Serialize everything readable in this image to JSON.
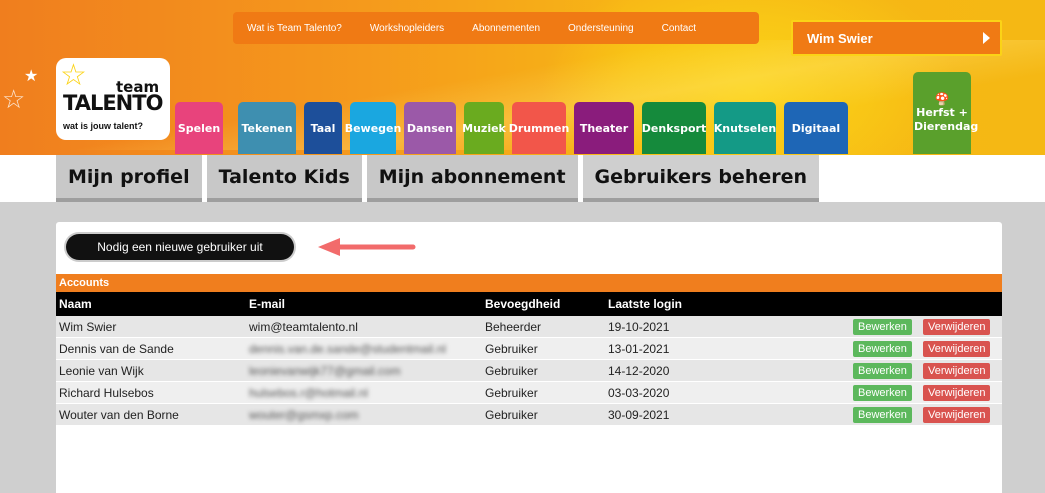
{
  "topnav": {
    "links": [
      "Wat is Team Talento?",
      "Workshopleiders",
      "Abonnementen",
      "Ondersteuning",
      "Contact"
    ]
  },
  "user": {
    "name": "Wim Swier"
  },
  "logo": {
    "line1": "team",
    "line2": "TALENTO",
    "tagline": "wat is jouw talent?"
  },
  "categories": [
    {
      "label": "Spelen",
      "color": "#e8437c"
    },
    {
      "label": "Tekenen",
      "color": "#3e8fb0"
    },
    {
      "label": "Taal",
      "color": "#1d4f9a"
    },
    {
      "label": "Bewegen",
      "color": "#1aa7e0"
    },
    {
      "label": "Dansen",
      "color": "#9b59a8"
    },
    {
      "label": "Muziek",
      "color": "#6aab1f"
    },
    {
      "label": "Drummen",
      "color": "#f2564a"
    },
    {
      "label": "Theater",
      "color": "#8a1c7c"
    },
    {
      "label": "Denksport",
      "color": "#158a3c"
    },
    {
      "label": "Knutselen",
      "color": "#149a86"
    },
    {
      "label": "Digitaal",
      "color": "#1e66b6"
    },
    {
      "label": "Herfst + Dierendag",
      "color": "#5aa02c"
    }
  ],
  "profile_tabs": [
    "Mijn profiel",
    "Talento Kids",
    "Mijn abonnement",
    "Gebruikers beheren"
  ],
  "invite_button": "Nodig een nieuwe gebruiker uit",
  "table": {
    "title": "Accounts",
    "headers": [
      "Naam",
      "E-mail",
      "Bevoegdheid",
      "Laatste login"
    ],
    "edit_label": "Bewerken",
    "delete_label": "Verwijderen",
    "rows": [
      {
        "name": "Wim Swier",
        "email": "wim@teamtalento.nl",
        "email_blurred": false,
        "role": "Beheerder",
        "login": "19-10-2021"
      },
      {
        "name": "Dennis van de Sande",
        "email": "dennis.van.de.sande@studentmail.nl",
        "email_blurred": true,
        "role": "Gebruiker",
        "login": "13-01-2021"
      },
      {
        "name": "Leonie van Wijk",
        "email": "leonievanwijk77@gmail.com",
        "email_blurred": true,
        "role": "Gebruiker",
        "login": "14-12-2020"
      },
      {
        "name": "Richard Hulsebos",
        "email": "hulsebos.r@hotmail.nl",
        "email_blurred": true,
        "role": "Gebruiker",
        "login": "03-03-2020"
      },
      {
        "name": "Wouter van den Borne",
        "email": "wouter@gsmxp.com",
        "email_blurred": true,
        "role": "Gebruiker",
        "login": "30-09-2021"
      }
    ]
  }
}
